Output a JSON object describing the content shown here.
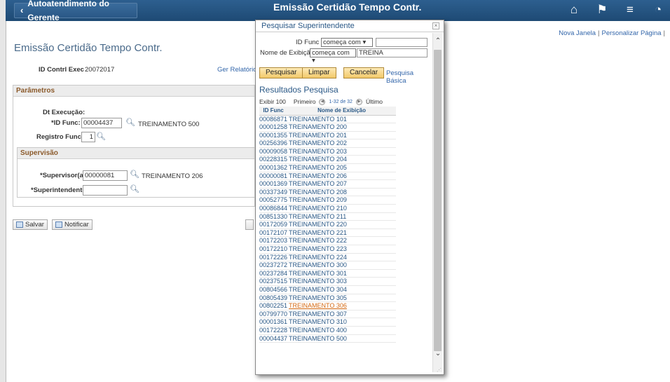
{
  "header": {
    "back_label": "Autoatendimento do Gerente",
    "page_heading": "Emissão Certidão Tempo Contr."
  },
  "toplinks": {
    "new_window": "Nova Janela",
    "personalize": "Personalizar Página"
  },
  "page": {
    "title": "Emissão Certidão Tempo Contr.",
    "id_control_label": "ID Contrl Exec",
    "id_control_value": "20072017",
    "reports_link": "Ger Relatórios"
  },
  "parametros": {
    "header": "Parâmetros",
    "dt_exec_label": "Dt Execução:",
    "id_func_label": "*ID Func:",
    "id_func_value": "00004437",
    "id_func_name": "TREINAMENTO 500",
    "registro_label": "Registro Func:",
    "registro_value": "1"
  },
  "supervisao": {
    "header": "Supervisão",
    "supervisor_label": "*Supervisor(a):",
    "supervisor_value": "00000081",
    "supervisor_name": "TREINAMENTO 206",
    "superintendente_label": "*Superintendente:",
    "superintendente_value": ""
  },
  "buttons": {
    "save": "Salvar",
    "notify": "Notificar"
  },
  "modal": {
    "title": "Pesquisar Superintendente",
    "close": "×",
    "id_func_label": "ID Func",
    "id_func_operator": "começa com",
    "id_func_value": "",
    "name_label": "Nome de Exibição",
    "name_operator": "começa com",
    "name_value": "TREINA",
    "search_btn": "Pesquisar",
    "clear_btn": "Limpar",
    "cancel_btn": "Cancelar",
    "basic_link": "Pesquisa Básica",
    "results_title": "Resultados Pesquisa",
    "show": "Exibir 100",
    "first": "Primeiro",
    "range": "1-32 de 32",
    "last": "Último",
    "col_id": "ID Func",
    "col_name": "Nome de Exibição",
    "rows": [
      {
        "id": "00086871",
        "name": "TREINAMENTO 101"
      },
      {
        "id": "00001258",
        "name": "TREINAMENTO 200"
      },
      {
        "id": "00001355",
        "name": "TREINAMENTO 201"
      },
      {
        "id": "00256396",
        "name": "TREINAMENTO 202"
      },
      {
        "id": "00009058",
        "name": "TREINAMENTO 203"
      },
      {
        "id": "00228315",
        "name": "TREINAMENTO 204"
      },
      {
        "id": "00001362",
        "name": "TREINAMENTO 205"
      },
      {
        "id": "00000081",
        "name": "TREINAMENTO 206"
      },
      {
        "id": "00001369",
        "name": "TREINAMENTO 207"
      },
      {
        "id": "00337349",
        "name": "TREINAMENTO 208"
      },
      {
        "id": "00052775",
        "name": "TREINAMENTO 209"
      },
      {
        "id": "00086844",
        "name": "TREINAMENTO 210"
      },
      {
        "id": "00851330",
        "name": "TREINAMENTO 211"
      },
      {
        "id": "00172059",
        "name": "TREINAMENTO 220"
      },
      {
        "id": "00172107",
        "name": "TREINAMENTO 221"
      },
      {
        "id": "00172203",
        "name": "TREINAMENTO 222"
      },
      {
        "id": "00172210",
        "name": "TREINAMENTO 223"
      },
      {
        "id": "00172226",
        "name": "TREINAMENTO 224"
      },
      {
        "id": "00237272",
        "name": "TREINAMENTO 300"
      },
      {
        "id": "00237284",
        "name": "TREINAMENTO 301"
      },
      {
        "id": "00237515",
        "name": "TREINAMENTO 303"
      },
      {
        "id": "00804566",
        "name": "TREINAMENTO 304"
      },
      {
        "id": "00805439",
        "name": "TREINAMENTO 305"
      },
      {
        "id": "00802251",
        "name": "TREINAMENTO 306",
        "highlight": true
      },
      {
        "id": "00799770",
        "name": "TREINAMENTO 307"
      },
      {
        "id": "00001361",
        "name": "TREINAMENTO 310"
      },
      {
        "id": "00172228",
        "name": "TREINAMENTO 400"
      },
      {
        "id": "00004437",
        "name": "TREINAMENTO 500"
      }
    ]
  },
  "colors": {
    "header_bg": "#1e4a74",
    "link": "#3366aa",
    "section_header_text": "#8b5a2b",
    "highlight": "#d46a14"
  }
}
